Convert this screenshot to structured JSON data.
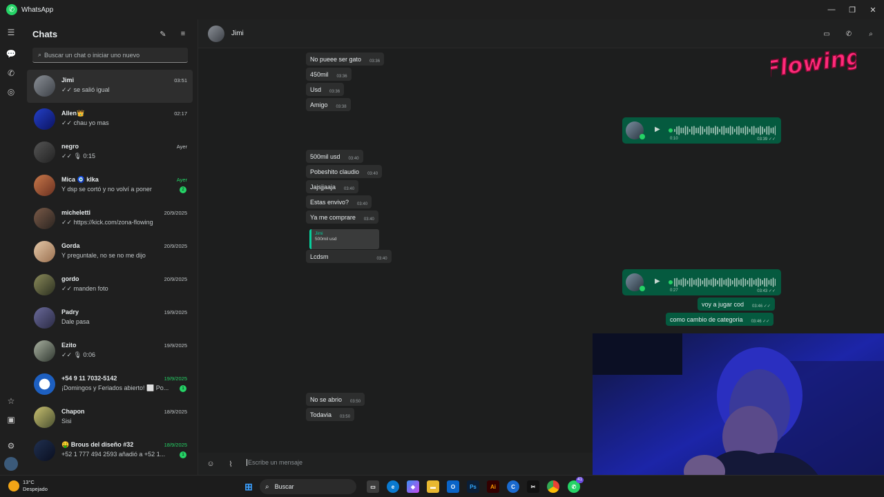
{
  "window": {
    "title": "WhatsApp",
    "controls": [
      "—",
      "❐",
      "✕"
    ]
  },
  "sidebar": {
    "title": "Chats",
    "search_placeholder": "Buscar un chat o iniciar uno nuevo",
    "chats": [
      {
        "name": "Jimi",
        "time": "03:51",
        "message": "✓✓ se salió igual",
        "active": true
      },
      {
        "name": "Allen👑",
        "time": "02:17",
        "message": "✓✓ chau yo mas"
      },
      {
        "name": "negro",
        "time": "Ayer",
        "message": "✓✓ 🎙 0:15"
      },
      {
        "name": "Mica 🧿 klka",
        "time": "Ayer",
        "message": "Y dsp se cortó y no volví a poner",
        "unread": "2",
        "time_green": true
      },
      {
        "name": "micheletti",
        "time": "20/9/2025",
        "message": "✓✓ https://kick.com/zona-flowing"
      },
      {
        "name": "Gorda",
        "time": "20/9/2025",
        "message": "Y preguntale, no se no me dijo"
      },
      {
        "name": "gordo",
        "time": "20/9/2025",
        "message": "✓✓ manden foto"
      },
      {
        "name": "Padry",
        "time": "19/9/2025",
        "message": "Dale pasa"
      },
      {
        "name": "Ezito",
        "time": "19/9/2025",
        "message": "✓✓ 🎙 0:06"
      },
      {
        "name": "+54 9 11 7032-5142",
        "time": "19/9/2025",
        "message": "¡Domingos y Feriados abierto! ⬜ Po...",
        "unread": "1",
        "time_green": true
      },
      {
        "name": "Chapon",
        "time": "18/9/2025",
        "message": "Sisi"
      },
      {
        "name": "🤑 Brous del diseño #32",
        "time": "18/9/2025",
        "message": "+52 1 777 494 2593 añadió a +52 1...",
        "unread": "1",
        "time_green": true
      }
    ]
  },
  "conversation": {
    "contact": "Jimi",
    "incoming": [
      {
        "text": "No pueee ser gato",
        "time": "03:36"
      },
      {
        "text": "450mil",
        "time": "03:36"
      },
      {
        "text": "Usd",
        "time": "03:36"
      },
      {
        "text": "Amigo",
        "time": "03:38"
      },
      {
        "text": "500mil usd",
        "time": "03:40"
      },
      {
        "text": "Pobeshito claudio",
        "time": "03:40"
      },
      {
        "text": "Jajsjjaaja",
        "time": "03:40"
      },
      {
        "text": "Estas envivo?",
        "time": "03:40"
      },
      {
        "text": "Ya me comprare",
        "time": "03:40"
      },
      {
        "text": "Lcdsm",
        "time": "03:40"
      },
      {
        "text": "No se abrio",
        "time": "03:50"
      },
      {
        "text": "Todavia",
        "time": "03:50"
      }
    ],
    "quote": {
      "author": "Jimi",
      "text": "500mil usd"
    },
    "voice_notes": [
      {
        "duration": "0:10",
        "time": "03:39 ✓✓"
      },
      {
        "duration": "0:27",
        "time": "03:43 ✓✓"
      }
    ],
    "outgoing": [
      {
        "text": "voy a jugar cod",
        "time": "03:46 ✓✓"
      },
      {
        "text": "como cambio de categoria",
        "time": "03:46 ✓✓"
      }
    ],
    "composer_placeholder": "Escribe un mensaje"
  },
  "overlay": {
    "brand_text": "Flowing"
  },
  "taskbar": {
    "weather_temp": "13°C",
    "weather_desc": "Despejado",
    "search_label": "Buscar",
    "apps": [
      "Ps",
      "Ai"
    ],
    "badge": "41"
  },
  "colors": {
    "accent": "#25d366",
    "outgoing_bubble": "#055a3f",
    "incoming_bubble": "#2d2e2e",
    "brand": "#ff2a7a"
  }
}
